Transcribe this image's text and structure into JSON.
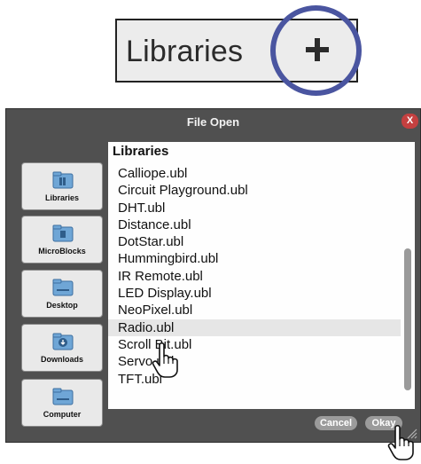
{
  "callout": {
    "label": "Libraries",
    "plus_icon": "plus-icon",
    "highlight_color": "#4a55a0"
  },
  "dialog": {
    "title": "File Open",
    "close_label": "X",
    "heading": "Libraries",
    "locations": [
      {
        "label": "Libraries",
        "icon": "library-folder-icon"
      },
      {
        "label": "MicroBlocks",
        "icon": "microblocks-folder-icon"
      },
      {
        "label": "Desktop",
        "icon": "desktop-folder-icon"
      },
      {
        "label": "Downloads",
        "icon": "downloads-folder-icon"
      },
      {
        "label": "Computer",
        "icon": "computer-folder-icon"
      }
    ],
    "files": [
      "Calliope.ubl",
      "Circuit Playground.ubl",
      "DHT.ubl",
      "Distance.ubl",
      "DotStar.ubl",
      "Hummingbird.ubl",
      "IR Remote.ubl",
      "LED Display.ubl",
      "NeoPixel.ubl",
      "Radio.ubl",
      "Scroll Bit.ubl",
      "Servo.ubl",
      "TFT.ubl"
    ],
    "selected_file": "Radio.ubl",
    "cancel_label": "Cancel",
    "okay_label": "Okay",
    "colors": {
      "titlebar": "#505050",
      "close": "#c44040",
      "buttons": "#9b9b9b"
    }
  }
}
